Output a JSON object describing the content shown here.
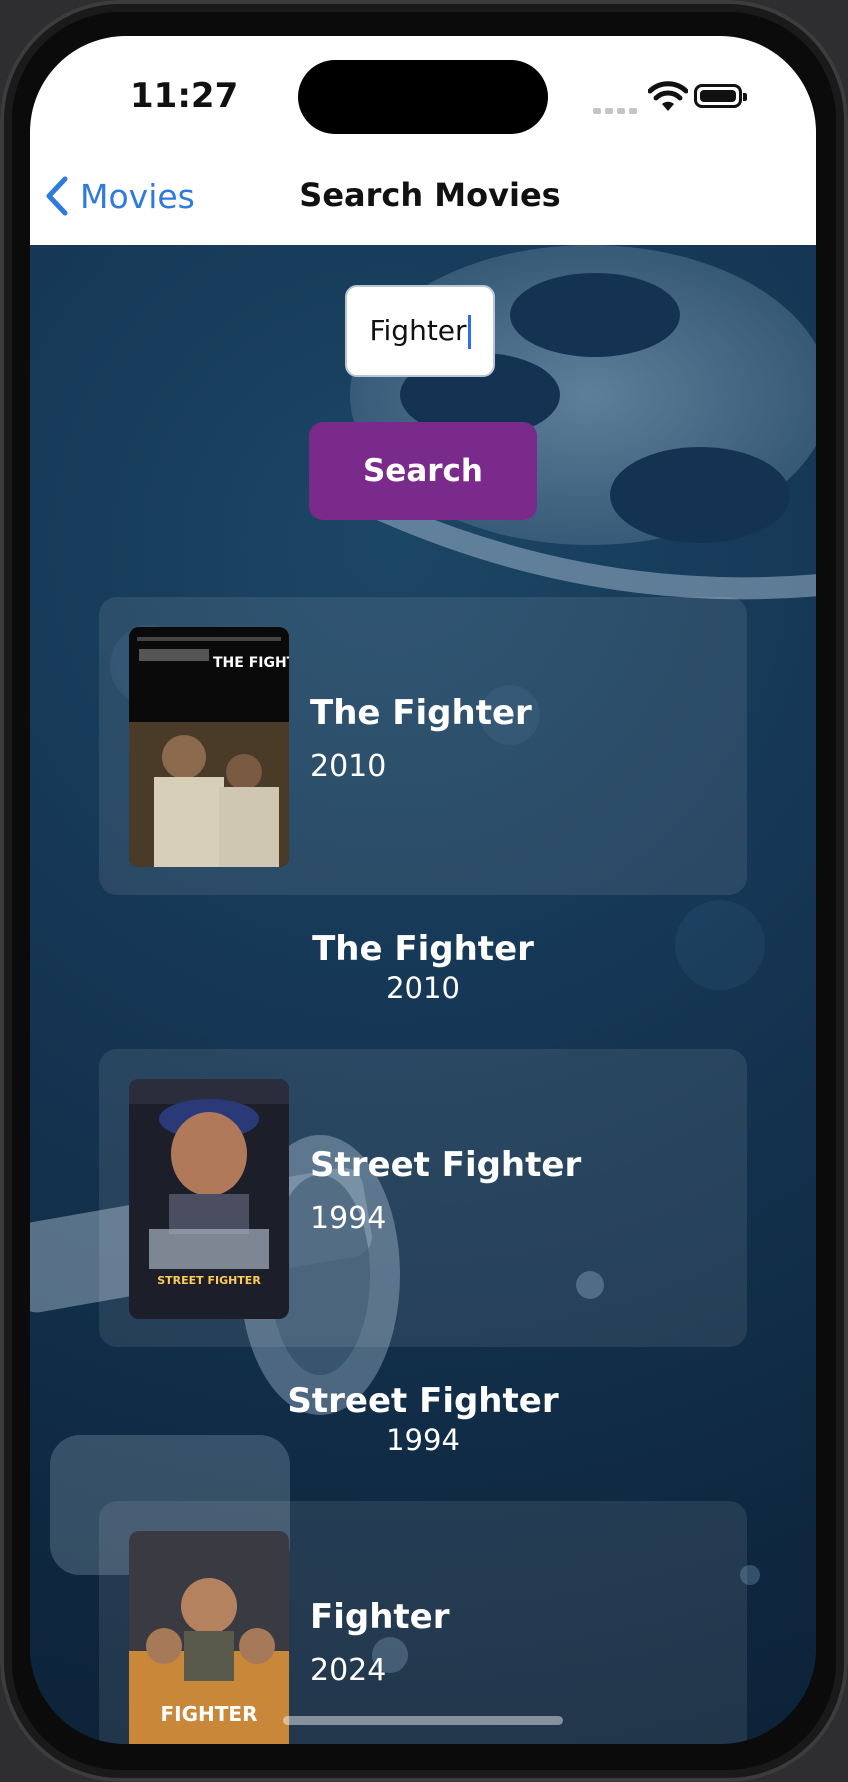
{
  "status_bar": {
    "time": "11:27"
  },
  "nav": {
    "back_label": "Movies",
    "title": "Search Movies"
  },
  "search": {
    "value": "Fighter",
    "button_label": "Search"
  },
  "results": [
    {
      "title": "The Fighter",
      "year": "2010",
      "poster_text": "THE FIGHTER"
    },
    {
      "title": "Street Fighter",
      "year": "1994",
      "poster_text": "STREET FIGHTER"
    },
    {
      "title": "Fighter",
      "year": "2024",
      "poster_text": "FIGHTER"
    }
  ],
  "colors": {
    "accent": "#2f7bdd",
    "search_button": "#7a2a8a",
    "background": "#153654"
  }
}
